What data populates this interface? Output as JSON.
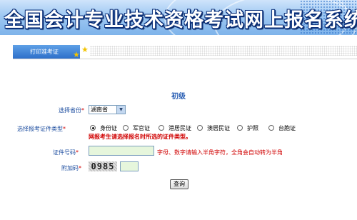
{
  "header": {
    "title": "全国会计专业技术资格考试网上报名系统"
  },
  "tabs": [
    {
      "label": "打印准考证"
    }
  ],
  "main": {
    "level": "初级",
    "province": {
      "label": "选择省份",
      "required_mark": "*",
      "value": "湖南省"
    },
    "id_type": {
      "label": "选择报考证件类型",
      "required_mark": "*",
      "options": [
        "身份证",
        "军官证",
        "港居民证",
        "澳居民证",
        "护照",
        "台胞证"
      ],
      "selected": "身份证",
      "warning": "网报考生请选择报名时所选的证件类型。"
    },
    "id_number": {
      "label": "证件号码",
      "required_mark": "*",
      "value": "",
      "hint": "字母、数字请输入半角字符，全角会自动转为半角"
    },
    "captcha": {
      "label": "附加码",
      "required_mark": "*",
      "code": "0985",
      "value": ""
    },
    "submit_label": "查询"
  },
  "colors": {
    "label": "#1f4fa0",
    "required": "#d00000",
    "tab": "#3f82d6",
    "input_bg": "#e6f6dc"
  }
}
